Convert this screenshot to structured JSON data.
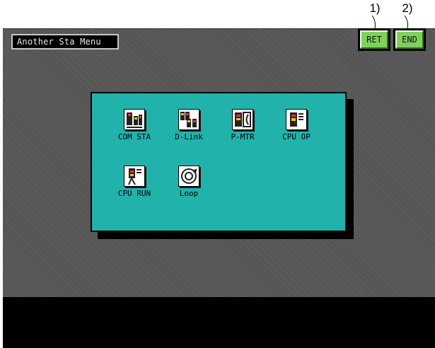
{
  "callouts": [
    "1)",
    "2)"
  ],
  "title_label": "Another Sta Menu",
  "buttons": {
    "ret": "RET",
    "end": "END"
  },
  "menu": {
    "items": [
      {
        "label": "COM STA",
        "icon": "com-sta-icon"
      },
      {
        "label": "D-Link",
        "icon": "d-link-icon"
      },
      {
        "label": "P-MTR",
        "icon": "p-mtr-icon"
      },
      {
        "label": "CPU OP",
        "icon": "cpu-op-icon"
      },
      {
        "label": "CPU RUN",
        "icon": "cpu-run-icon"
      },
      {
        "label": "Loop",
        "icon": "loop-icon"
      }
    ]
  },
  "colors": {
    "panel": "#22b2ac",
    "button": "#7fd15c",
    "background": "#5c5c5c",
    "bottom_bar": "#000000"
  }
}
